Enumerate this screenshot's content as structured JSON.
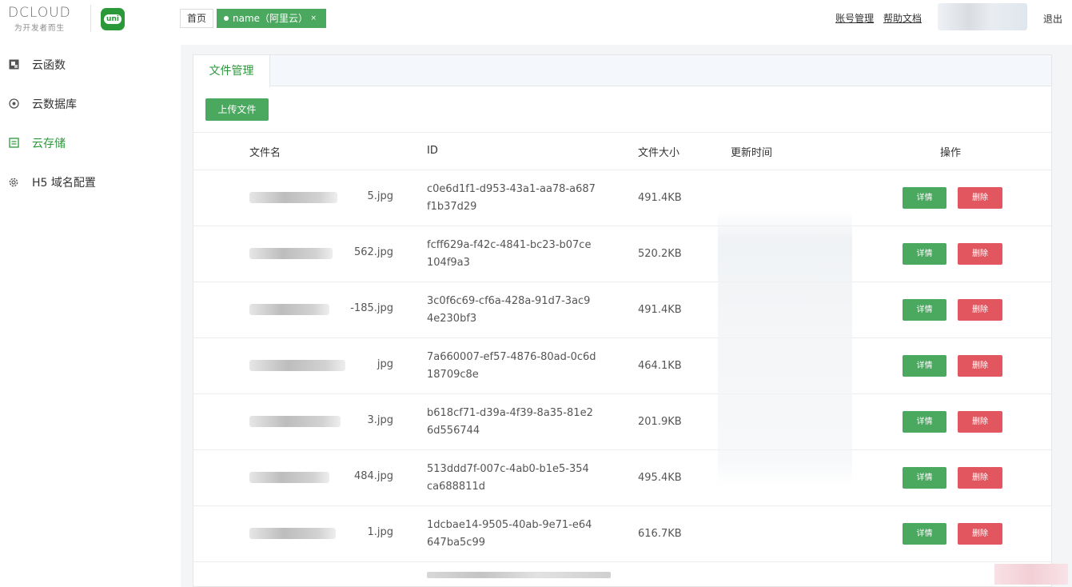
{
  "brand": {
    "name": "DCLOUD",
    "slogan": "为开发者而生",
    "uni_label": "uni"
  },
  "sidebar": {
    "items": [
      {
        "label": "云函数",
        "icon": "function-icon",
        "active": false
      },
      {
        "label": "云数据库",
        "icon": "database-icon",
        "active": false
      },
      {
        "label": "云存储",
        "icon": "storage-icon",
        "active": true
      },
      {
        "label": "H5 域名配置",
        "icon": "gear-icon",
        "active": false
      }
    ]
  },
  "header": {
    "home_tag": "首页",
    "active_tag": "name（阿里云）",
    "close_glyph": "×",
    "account_link": "账号管理",
    "help_link": "帮助文档",
    "logout": "退出"
  },
  "main": {
    "tab_label": "文件管理",
    "upload_button": "上传文件",
    "columns": [
      "文件名",
      "ID",
      "文件大小",
      "更新时间",
      "操作"
    ],
    "detail_label": "详情",
    "delete_label": "删除",
    "rows": [
      {
        "name_suffix": "5.jpg",
        "id_line1": "c0e6d1f1-d953-43a1-aa78-a687",
        "id_line2": "f1b37d29",
        "size": "491.4KB"
      },
      {
        "name_suffix": "562.jpg",
        "id_line1": "fcff629a-f42c-4841-bc23-b07ce",
        "id_line2": "104f9a3",
        "size": "520.2KB"
      },
      {
        "name_suffix": "-185.jpg",
        "id_line1": "3c0f6c69-cf6a-428a-91d7-3ac9",
        "id_line2": "4e230bf3",
        "size": "491.4KB"
      },
      {
        "name_suffix": "jpg",
        "id_line1": "7a660007-ef57-4876-80ad-0c6d",
        "id_line2": "18709c8e",
        "size": "464.1KB"
      },
      {
        "name_suffix": "3.jpg",
        "id_line1": "b618cf71-d39a-4f39-8a35-81e2",
        "id_line2": "6d556744",
        "size": "201.9KB"
      },
      {
        "name_suffix": "484.jpg",
        "id_line1": "513ddd7f-007c-4ab0-b1e5-354",
        "id_line2": "ca688811d",
        "size": "495.4KB"
      },
      {
        "name_suffix": "1.jpg",
        "id_line1": "1dcbae14-9505-40ab-9e71-e64",
        "id_line2": "647ba5c99",
        "size": "616.7KB"
      }
    ]
  },
  "colors": {
    "primary": "#4aa85f",
    "danger": "#e2565f",
    "active_text": "#2b9939"
  }
}
